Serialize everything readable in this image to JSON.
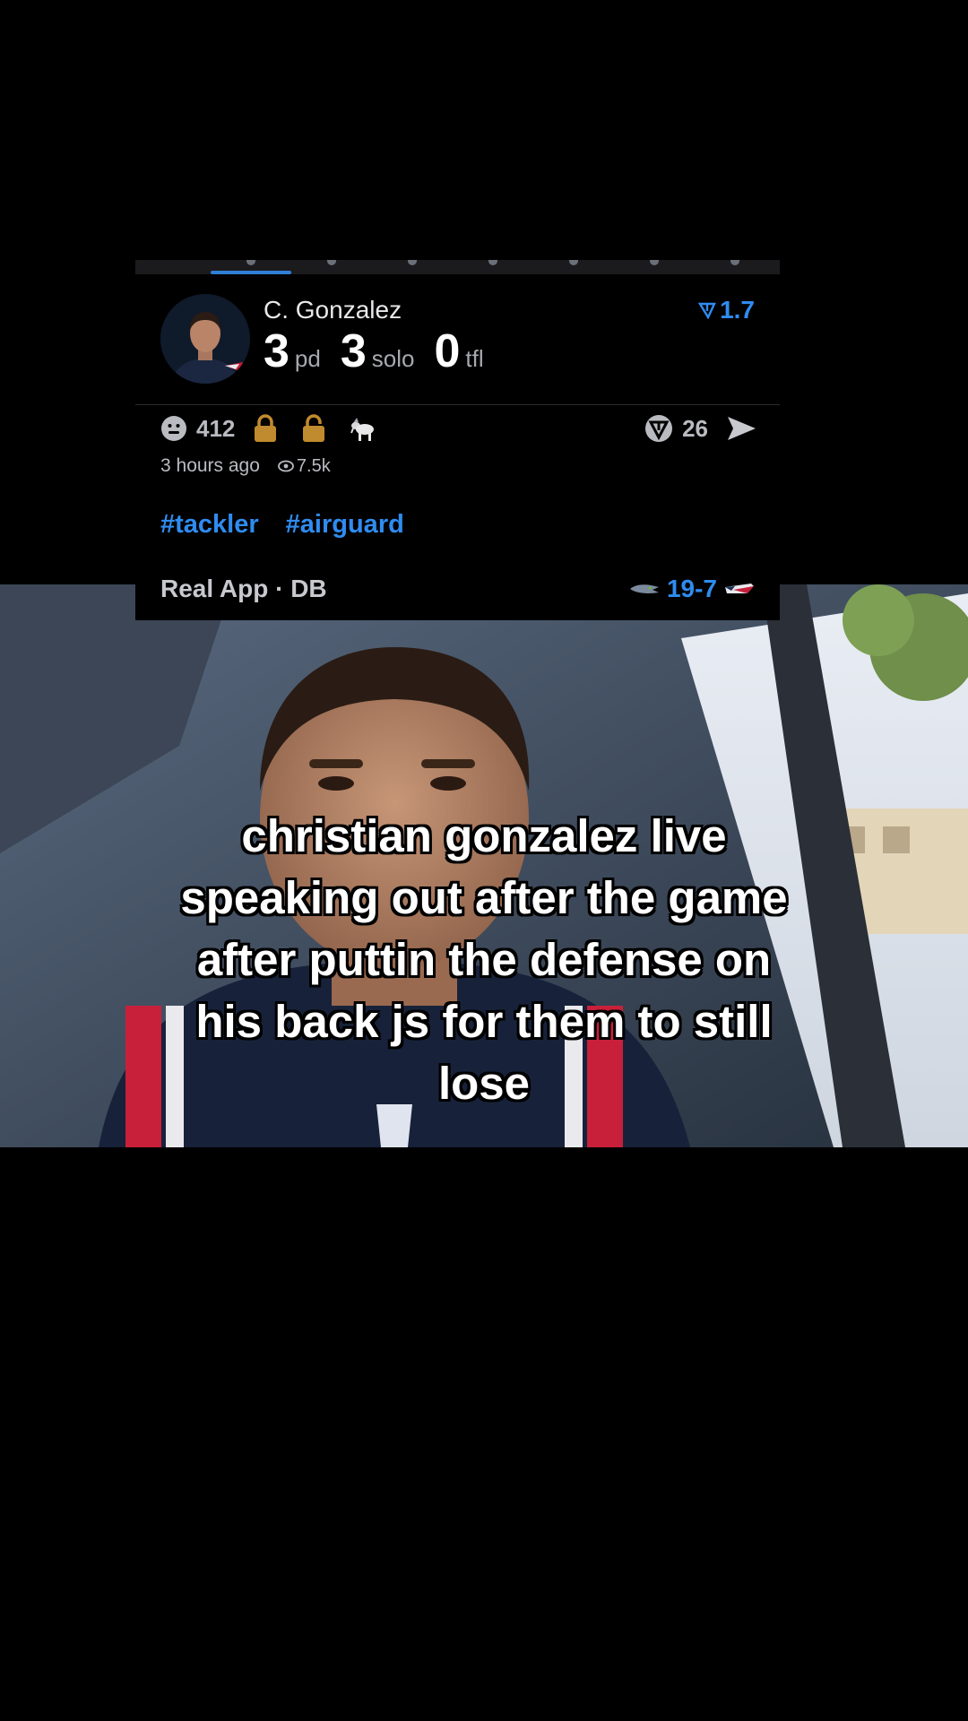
{
  "card": {
    "player": {
      "name": "C. Gonzalez",
      "rating": "1.7"
    },
    "stats": [
      {
        "value": "3",
        "label": "pd"
      },
      {
        "value": "3",
        "label": "solo"
      },
      {
        "value": "0",
        "label": "tfl"
      }
    ],
    "reactions": {
      "count": "412",
      "icons": [
        "smiley-icon",
        "lock-icon",
        "unlock-icon",
        "goat-icon"
      ]
    },
    "actions": {
      "coins": "26",
      "share_icon": "send-icon"
    },
    "meta": {
      "time": "3 hours ago",
      "views": "7.5k"
    },
    "tags": [
      "#tackler",
      "#airguard"
    ],
    "source": "Real App · DB",
    "score": "19-7",
    "colors": {
      "accent": "#2f8cf0",
      "lock": "#c08a2e"
    }
  },
  "caption": {
    "lines": [
      "christian gonzalez live",
      "speaking out after the game",
      "after puttin the defense on",
      "his back js for them to still",
      "lose"
    ]
  }
}
